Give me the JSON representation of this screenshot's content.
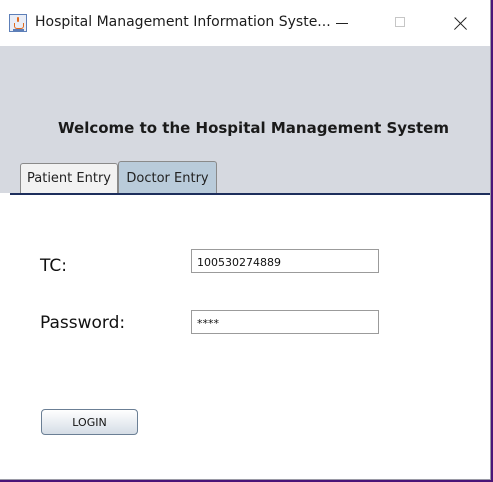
{
  "window": {
    "title": "Hospital Management Information Syste..."
  },
  "header": {
    "welcome": "Welcome to the Hospital Management System"
  },
  "tabs": [
    {
      "label": "Patient Entry",
      "selected": false
    },
    {
      "label": "Doctor Entry",
      "selected": true
    }
  ],
  "form": {
    "tc_label": "TC:",
    "tc_value": "100530274889",
    "password_label": "Password:",
    "password_value": "****",
    "login_label": "LOGIN"
  },
  "colors": {
    "header_bg": "#d6d9e0",
    "selected_tab": "#b9cbda",
    "tab_underline": "#1d2e5c"
  },
  "icons": {
    "app": "java-cup-icon",
    "minimize": "minimize-icon",
    "maximize": "maximize-icon",
    "close": "close-icon"
  }
}
